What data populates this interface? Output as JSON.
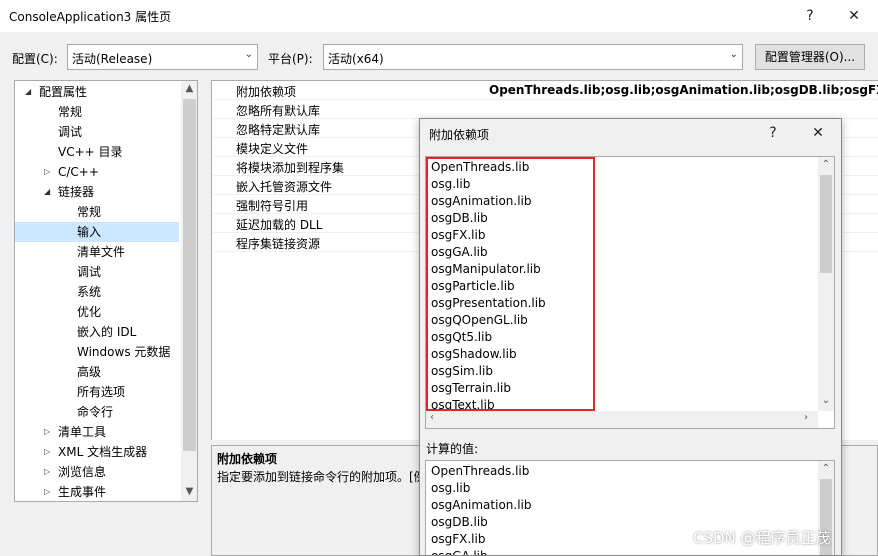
{
  "window": {
    "title": "ConsoleApplication3 属性页",
    "help_glyph": "?",
    "close_glyph": "✕"
  },
  "config": {
    "config_label": "配置(C):",
    "config_value": "活动(Release)",
    "platform_label": "平台(P):",
    "platform_value": "活动(x64)",
    "manager_button": "配置管理器(O)..."
  },
  "tree": {
    "items": [
      {
        "label": "配置属性",
        "level": 0,
        "expanded": true
      },
      {
        "label": "常规",
        "level": 1
      },
      {
        "label": "调试",
        "level": 1
      },
      {
        "label": "VC++ 目录",
        "level": 1
      },
      {
        "label": "C/C++",
        "level": 1,
        "collapsed": true
      },
      {
        "label": "链接器",
        "level": 1,
        "expanded": true
      },
      {
        "label": "常规",
        "level": 2
      },
      {
        "label": "输入",
        "level": 2,
        "selected": true
      },
      {
        "label": "清单文件",
        "level": 2
      },
      {
        "label": "调试",
        "level": 2
      },
      {
        "label": "系统",
        "level": 2
      },
      {
        "label": "优化",
        "level": 2
      },
      {
        "label": "嵌入的 IDL",
        "level": 2
      },
      {
        "label": "Windows 元数据",
        "level": 2
      },
      {
        "label": "高级",
        "level": 2
      },
      {
        "label": "所有选项",
        "level": 2
      },
      {
        "label": "命令行",
        "level": 2
      },
      {
        "label": "清单工具",
        "level": 1,
        "collapsed": true
      },
      {
        "label": "XML 文档生成器",
        "level": 1,
        "collapsed": true
      },
      {
        "label": "浏览信息",
        "level": 1,
        "collapsed": true
      },
      {
        "label": "生成事件",
        "level": 1,
        "collapsed": true
      }
    ]
  },
  "grid": {
    "rows": [
      {
        "name": "附加依赖项",
        "value": "OpenThreads.lib;osg.lib;osgAnimation.lib;osgDB.lib;osgFX.lib;"
      },
      {
        "name": "忽略所有默认库",
        "value": ""
      },
      {
        "name": "忽略特定默认库",
        "value": ""
      },
      {
        "name": "模块定义文件",
        "value": ""
      },
      {
        "name": "将模块添加到程序集",
        "value": ""
      },
      {
        "name": "嵌入托管资源文件",
        "value": ""
      },
      {
        "name": "强制符号引用",
        "value": ""
      },
      {
        "name": "延迟加载的 DLL",
        "value": ""
      },
      {
        "name": "程序集链接资源",
        "value": ""
      }
    ]
  },
  "description": {
    "title": "附加依赖项",
    "text": "指定要添加到链接命令行的附加项。[例"
  },
  "dialog": {
    "title": "附加依赖项",
    "help_glyph": "?",
    "close_glyph": "✕",
    "libs": [
      "OpenThreads.lib",
      "osg.lib",
      "osgAnimation.lib",
      "osgDB.lib",
      "osgFX.lib",
      "osgGA.lib",
      "osgManipulator.lib",
      "osgParticle.lib",
      "osgPresentation.lib",
      "osgQOpenGL.lib",
      "osgQt5.lib",
      "osgShadow.lib",
      "osgSim.lib",
      "osgTerrain.lib",
      "osgText.lib"
    ],
    "calc_label": "计算的值:",
    "calc_libs": [
      "OpenThreads.lib",
      "osg.lib",
      "osgAnimation.lib",
      "osgDB.lib",
      "osgFX.lib",
      "osgGA.lib"
    ]
  },
  "watermark": "CSDN @程序员正茂",
  "colors": {
    "highlight_box": "#e0232d",
    "selection": "#cce8ff"
  }
}
